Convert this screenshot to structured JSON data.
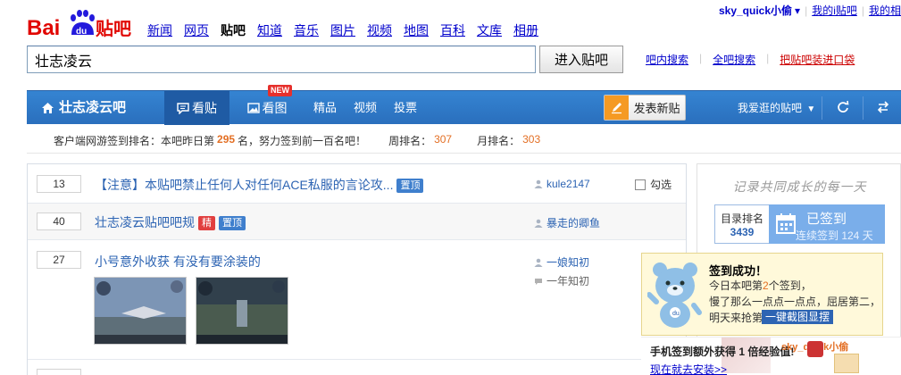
{
  "header": {
    "logo_text": "Bai du 贴吧",
    "nav": [
      "新闻",
      "网页",
      "贴吧",
      "知道",
      "音乐",
      "图片",
      "视频",
      "地图",
      "百科",
      "文库",
      "相册"
    ],
    "active_nav": "贴吧",
    "user_name": "sky_quick小偷",
    "user_links": [
      "我的i贴吧",
      "我的相"
    ]
  },
  "search": {
    "value": "壮志凌云",
    "button": "进入贴吧",
    "links": [
      "吧内搜索",
      "全吧搜索",
      "把贴吧装进口袋"
    ]
  },
  "forum_nav": {
    "forum_name": "壮志凌云吧",
    "tab_posts": "看贴",
    "tab_pics": "看图",
    "new_badge": "NEW",
    "tab_elite": "精品",
    "tab_video": "视频",
    "tab_vote": "投票",
    "post_button": "发表新贴",
    "my_forums": "我爱逛的贴吧"
  },
  "rank_bar": {
    "prefix": "客户端网游签到排名：本吧昨日第",
    "rank": "295",
    "suffix": "名，努力签到前一百名吧！",
    "week_label": "周排名：",
    "week_value": "307",
    "month_label": "月排名：",
    "month_value": "303"
  },
  "threads": [
    {
      "replies": "13",
      "title": "【注意】本贴吧禁止任何人对任何ACE私服的言论攻...",
      "tags": [
        "置顶"
      ],
      "author": "kule2147",
      "check_label": "勾选"
    },
    {
      "replies": "40",
      "title": "壮志凌云贴吧吧规",
      "tags": [
        "精",
        "置顶"
      ],
      "author": "暴走的卿鱼"
    },
    {
      "replies": "27",
      "title": "小号意外收获 有没有要涂装的",
      "author": "一娘知初",
      "last_reply": "一年知初"
    }
  ],
  "sidebar": {
    "slogan": "记录共同成长的每一天",
    "rank_label": "目录排名",
    "rank_value": "3439",
    "signed_label": "已签到",
    "signed_days": "连续签到 124 天"
  },
  "popup": {
    "title": "签到成功！",
    "line1_prefix": "今日本吧第",
    "line1_num": "2",
    "line1_suffix": "个签到，",
    "line2": "慢了那么一点点一点点，屈居第二，",
    "line3": "明天来抢第一~",
    "button": "一键截图显摆"
  },
  "mobile_strip": {
    "title": "手机签到额外获得 1 倍经验值!",
    "link": "现在就去安装>>",
    "user_hint": "sky_quick小偷"
  },
  "colors": {
    "nav_blue": "#2a6fbd",
    "link_blue": "#2d64b3",
    "accent_orange": "#e36f24",
    "popup_bg": "#fff9da"
  }
}
